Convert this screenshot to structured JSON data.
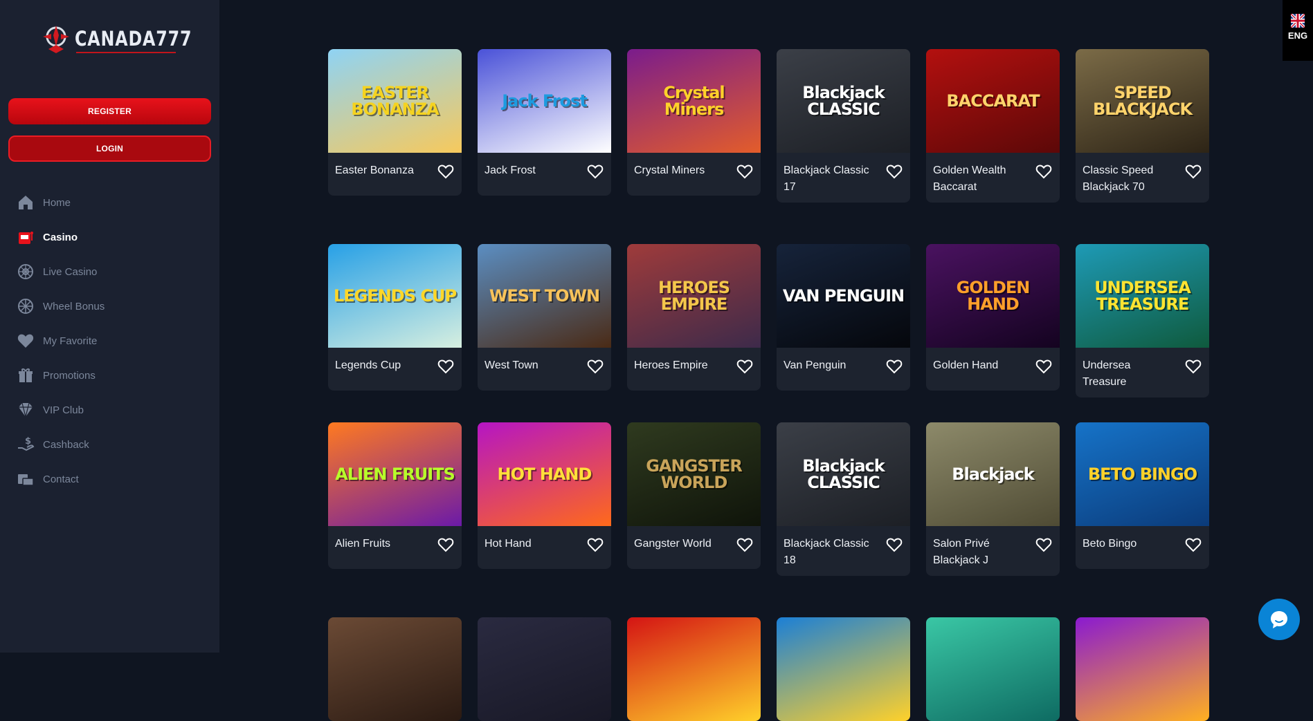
{
  "brand": {
    "name": "CANADA777"
  },
  "auth": {
    "register_label": "REGISTER",
    "login_label": "LOGIN"
  },
  "nav": [
    {
      "label": "Home",
      "icon": "home-icon",
      "active": false
    },
    {
      "label": "Casino",
      "icon": "slot-machine-icon",
      "active": true
    },
    {
      "label": "Live Casino",
      "icon": "roulette-icon",
      "active": false
    },
    {
      "label": "Wheel Bonus",
      "icon": "wheel-icon",
      "active": false
    },
    {
      "label": "My Favorite",
      "icon": "heart-icon",
      "active": false
    },
    {
      "label": "Promotions",
      "icon": "gift-icon",
      "active": false
    },
    {
      "label": "VIP Club",
      "icon": "diamond-icon",
      "active": false
    },
    {
      "label": "Cashback",
      "icon": "cashback-icon",
      "active": false
    },
    {
      "label": "Contact",
      "icon": "contact-icon",
      "active": false
    }
  ],
  "language": {
    "code": "ENG",
    "icon": "uk-flag-icon"
  },
  "games": [
    {
      "name": "Easter Bonanza",
      "art": "EASTER BONANZA",
      "c1": "#8fd3f4",
      "c2": "#f7c95c",
      "fg": "#f5d320"
    },
    {
      "name": "Jack Frost",
      "art": "Jack Frost",
      "c1": "#4a52d8",
      "c2": "#ffffff",
      "fg": "#1d9be0"
    },
    {
      "name": "Crystal Miners",
      "art": "Crystal Miners",
      "c1": "#7a1c8c",
      "c2": "#e35d2a",
      "fg": "#ffd12a"
    },
    {
      "name": "Blackjack Classic 17",
      "art": "Blackjack CLASSIC",
      "c1": "#3b3f47",
      "c2": "#1c1f25",
      "fg": "#ffffff"
    },
    {
      "name": "Golden Wealth Baccarat",
      "art": "BACCARAT",
      "c1": "#b3100f",
      "c2": "#5c0808",
      "fg": "#ffd36b"
    },
    {
      "name": "Classic Speed Blackjack 70",
      "art": "SPEED BLACKJACK",
      "c1": "#7b6b47",
      "c2": "#2d2416",
      "fg": "#ffd36b"
    },
    {
      "name": "Legends Cup",
      "art": "LEGENDS CUP",
      "c1": "#27a0e6",
      "c2": "#d7efe0",
      "fg": "#ffd728"
    },
    {
      "name": "West Town",
      "art": "WEST TOWN",
      "c1": "#5b8ec2",
      "c2": "#4a2a15",
      "fg": "#f7c25a"
    },
    {
      "name": "Heroes Empire",
      "art": "HEROES EMPIRE",
      "c1": "#9f3b3b",
      "c2": "#3d2a4a",
      "fg": "#f4c74b"
    },
    {
      "name": "Van Penguin",
      "art": "VAN PENGUIN",
      "c1": "#16233a",
      "c2": "#05070c",
      "fg": "#ffffff"
    },
    {
      "name": "Golden Hand",
      "art": "GOLDEN HAND",
      "c1": "#4a1260",
      "c2": "#140320",
      "fg": "#ff9f2a"
    },
    {
      "name": "Undersea Treasure",
      "art": "UNDERSEA TREASURE",
      "c1": "#1e9ab6",
      "c2": "#0f5a3d",
      "fg": "#ffe431"
    },
    {
      "name": "Alien Fruits",
      "art": "ALIEN FRUITS",
      "c1": "#ff7a20",
      "c2": "#6b1aa8",
      "fg": "#b7ff2a"
    },
    {
      "name": "Hot Hand",
      "art": "HOT HAND",
      "c1": "#b515c4",
      "c2": "#ff6a1a",
      "fg": "#ffdf3a"
    },
    {
      "name": "Gangster World",
      "art": "GANGSTER WORLD",
      "c1": "#2f3a1f",
      "c2": "#0f140a",
      "fg": "#c9a45a"
    },
    {
      "name": "Blackjack Classic 18",
      "art": "Blackjack CLASSIC",
      "c1": "#3b3f47",
      "c2": "#1c1f25",
      "fg": "#ffffff"
    },
    {
      "name": "Salon Privé Blackjack J",
      "art": "Blackjack",
      "c1": "#8d8a6a",
      "c2": "#4f4b34",
      "fg": "#ffffff"
    },
    {
      "name": "Beto Bingo",
      "art": "BETO BINGO",
      "c1": "#1673c8",
      "c2": "#0b3b7a",
      "fg": "#ffd12a"
    },
    {
      "name": "",
      "art": "",
      "c1": "#6b4a35",
      "c2": "#2a1a12",
      "fg": "#ffffff"
    },
    {
      "name": "",
      "art": "",
      "c1": "#2a2a40",
      "c2": "#181826",
      "fg": "#ffffff"
    },
    {
      "name": "",
      "art": "",
      "c1": "#d41414",
      "c2": "#ffd12a",
      "fg": "#ffffff"
    },
    {
      "name": "",
      "art": "",
      "c1": "#1b7fd6",
      "c2": "#ffd12a",
      "fg": "#ffffff"
    },
    {
      "name": "",
      "art": "",
      "c1": "#3ac7a5",
      "c2": "#0e6b62",
      "fg": "#ffffff"
    },
    {
      "name": "",
      "art": "",
      "c1": "#8a1ad0",
      "c2": "#ffb020",
      "fg": "#ffffff"
    }
  ],
  "colors": {
    "accent": "#e8121b",
    "sidebar_bg": "#1b2130",
    "page_bg": "#0f1521",
    "card_bg": "#1d232f",
    "chat": "#0a84d6"
  }
}
